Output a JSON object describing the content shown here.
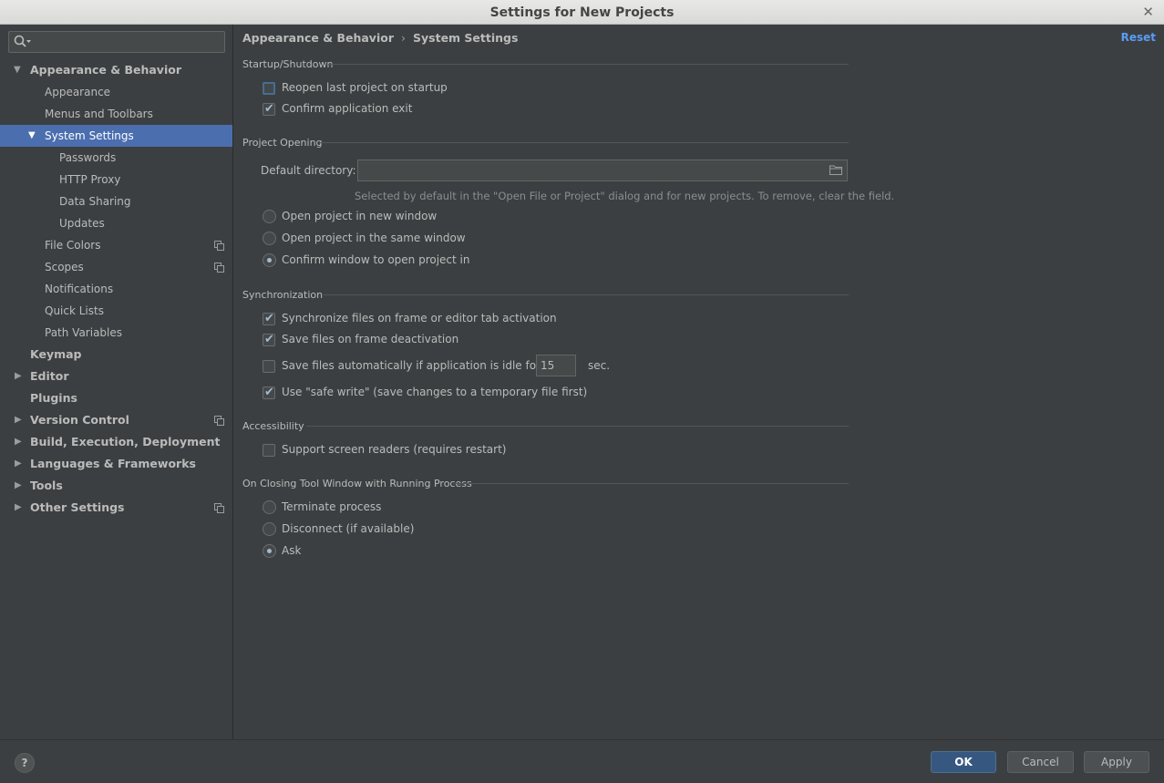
{
  "window": {
    "title": "Settings for New Projects"
  },
  "search": {
    "placeholder": ""
  },
  "sidebar": {
    "items": [
      {
        "label": "Appearance & Behavior"
      },
      {
        "label": "Appearance"
      },
      {
        "label": "Menus and Toolbars"
      },
      {
        "label": "System Settings"
      },
      {
        "label": "Passwords"
      },
      {
        "label": "HTTP Proxy"
      },
      {
        "label": "Data Sharing"
      },
      {
        "label": "Updates"
      },
      {
        "label": "File Colors"
      },
      {
        "label": "Scopes"
      },
      {
        "label": "Notifications"
      },
      {
        "label": "Quick Lists"
      },
      {
        "label": "Path Variables"
      },
      {
        "label": "Keymap"
      },
      {
        "label": "Editor"
      },
      {
        "label": "Plugins"
      },
      {
        "label": "Version Control"
      },
      {
        "label": "Build, Execution, Deployment"
      },
      {
        "label": "Languages & Frameworks"
      },
      {
        "label": "Tools"
      },
      {
        "label": "Other Settings"
      }
    ]
  },
  "breadcrumb": {
    "parent": "Appearance & Behavior",
    "separator": "›",
    "current": "System Settings"
  },
  "reset_label": "Reset",
  "startup": {
    "title": "Startup/Shutdown",
    "reopen_label": "Reopen last project on startup",
    "reopen_checked": false,
    "confirm_exit_label": "Confirm application exit",
    "confirm_exit_checked": true
  },
  "project_opening": {
    "title": "Project Opening",
    "default_dir_label": "Default directory:",
    "default_dir_value": "",
    "hint": "Selected by default in the \"Open File or Project\" dialog and for new projects. To remove, clear the field.",
    "options": [
      "Open project in new window",
      "Open project in the same window",
      "Confirm window to open project in"
    ],
    "selected": "Confirm window to open project in"
  },
  "sync": {
    "title": "Synchronization",
    "sync_label": "Synchronize files on frame or editor tab activation",
    "sync_checked": true,
    "save_deactivation_label": "Save files on frame deactivation",
    "save_deactivation_checked": true,
    "save_idle_label": "Save files automatically if application is idle for",
    "save_idle_checked": false,
    "idle_value": "15",
    "idle_unit": "sec.",
    "safe_write_label": "Use \"safe write\" (save changes to a temporary file first)",
    "safe_write_checked": true
  },
  "accessibility": {
    "title": "Accessibility",
    "screen_readers_label": "Support screen readers (requires restart)",
    "screen_readers_checked": false
  },
  "closing": {
    "title": "On Closing Tool Window with Running Process",
    "options": [
      "Terminate process",
      "Disconnect (if available)",
      "Ask"
    ],
    "selected": "Ask"
  },
  "footer": {
    "help": "?",
    "ok": "OK",
    "cancel": "Cancel",
    "apply": "Apply"
  },
  "colors": {
    "accent": "#4b6eaf",
    "link": "#589df6",
    "background": "#3c3f41"
  }
}
